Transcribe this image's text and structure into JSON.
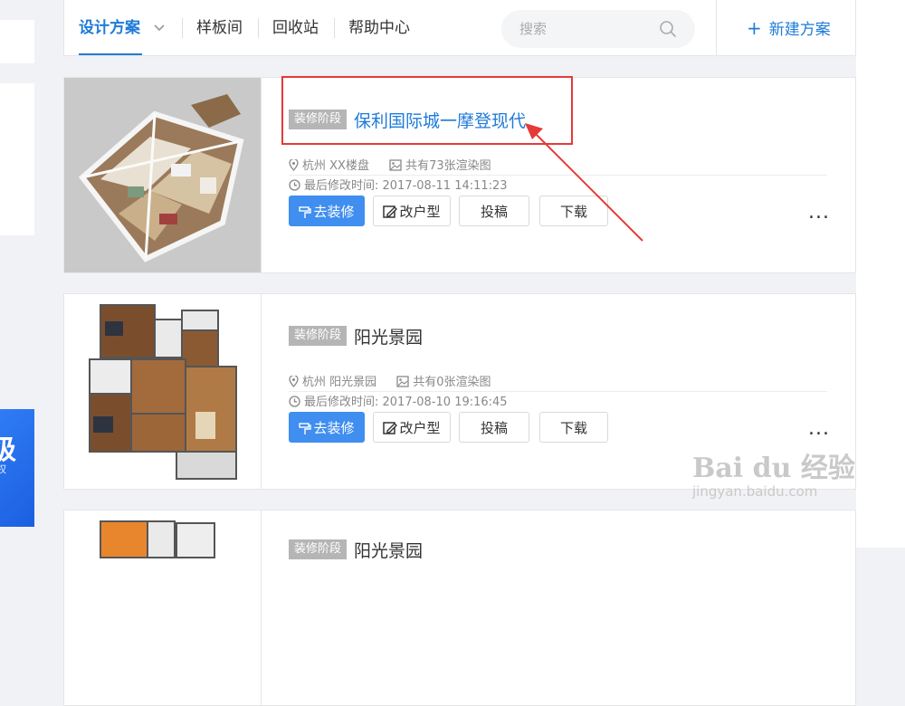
{
  "nav": {
    "tabs": [
      {
        "label": "设计方案"
      },
      {
        "label": "样板间"
      },
      {
        "label": "回收站"
      },
      {
        "label": "帮助中心"
      }
    ],
    "search_placeholder": "搜索",
    "new_label": "新建方案"
  },
  "side_banner": {
    "big": "级",
    "small": "权"
  },
  "projects": [
    {
      "stage": "装修阶段",
      "title": "保利国际城一摩登现代",
      "location": "杭州 XX楼盘",
      "renders": "共有73张渲染图",
      "modified": "最后修改时间: 2017-08-11 14:11:23",
      "actions": {
        "decorate": "去装修",
        "edit_layout": "改户型",
        "submit": "投稿",
        "download": "下载"
      },
      "more": "..."
    },
    {
      "stage": "装修阶段",
      "title": "阳光景园",
      "location": "杭州 阳光景园",
      "renders": "共有0张渲染图",
      "modified": "最后修改时间: 2017-08-10 19:16:45",
      "actions": {
        "decorate": "去装修",
        "edit_layout": "改户型",
        "submit": "投稿",
        "download": "下载"
      },
      "more": "..."
    },
    {
      "stage": "装修阶段",
      "title": "阳光景园"
    }
  ],
  "watermark": {
    "logo": "Bai du 经验",
    "url": "jingyan.baidu.com"
  },
  "colors": {
    "accent": "#1f7bd8",
    "primary_button": "#3f8ef0",
    "annotation": "#e53a3a"
  }
}
